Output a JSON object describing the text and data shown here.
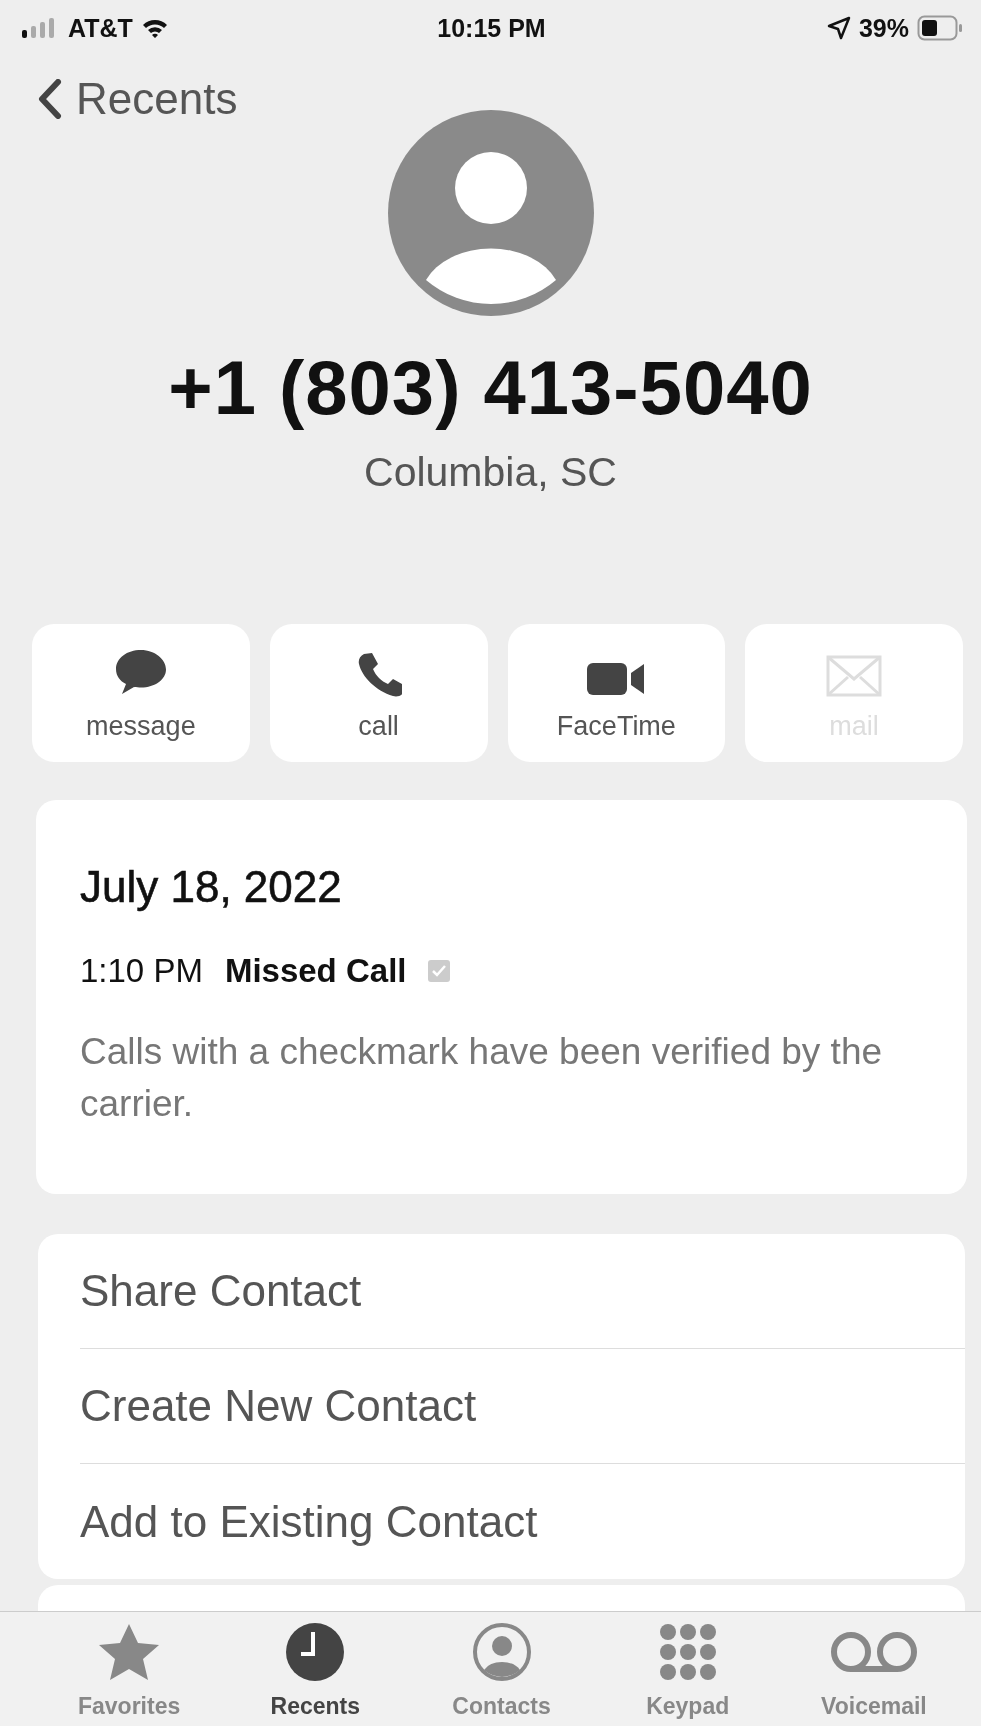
{
  "status_bar": {
    "carrier": "AT&T",
    "time": "10:15 PM",
    "battery": "39%"
  },
  "nav": {
    "back": "Recents"
  },
  "contact": {
    "number": "+1 (803) 413-5040",
    "location": "Columbia, SC"
  },
  "actions": [
    {
      "kind": "message",
      "label": "message",
      "disabled": false
    },
    {
      "kind": "call",
      "label": "call",
      "disabled": false
    },
    {
      "kind": "video",
      "label": "FaceTime",
      "disabled": false
    },
    {
      "kind": "mail",
      "label": "mail",
      "disabled": true
    }
  ],
  "call_log": {
    "date": "July 18, 2022",
    "time": "1:10 PM",
    "type": "Missed Call",
    "verified": true,
    "note": "Calls with a checkmark have been verified by the carrier."
  },
  "options": [
    "Share Contact",
    "Create New Contact",
    "Add to Existing Contact"
  ],
  "tabs": [
    {
      "kind": "star",
      "label": "Favorites",
      "selected": false
    },
    {
      "kind": "clock",
      "label": "Recents",
      "selected": true
    },
    {
      "kind": "person",
      "label": "Contacts",
      "selected": false
    },
    {
      "kind": "keypad",
      "label": "Keypad",
      "selected": false
    },
    {
      "kind": "voicemail",
      "label": "Voicemail",
      "selected": false
    }
  ]
}
